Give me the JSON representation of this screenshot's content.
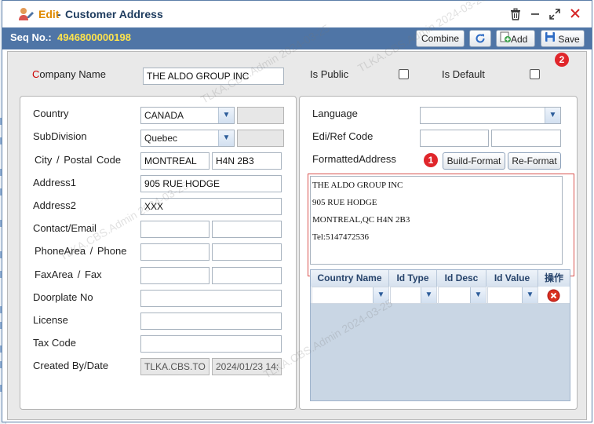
{
  "window": {
    "title_prefix": "Edit",
    "title_separator": "-",
    "title": "Customer Address",
    "icons": {
      "app": "user-edit-icon",
      "trash": "trash-icon",
      "minimize": "minimize-icon",
      "maximize": "maximize-icon",
      "close": "close-icon"
    }
  },
  "toolbar": {
    "seq_label": "Seq No.:",
    "seq_value": "4946800000198",
    "combine_label": "Combine",
    "add_label": "Add",
    "save_label": "Save"
  },
  "header_fields": {
    "company_name_label_first": "C",
    "company_name_label_rest": "ompany Name",
    "company_name_value": "THE ALDO GROUP INC",
    "is_public_label": "Is Public",
    "is_default_label": "Is Default"
  },
  "left": {
    "country_label": "Country",
    "country_value": "CANADA",
    "subdivision_label": "SubDivision",
    "subdivision_value": "Quebec",
    "city_postal_label": "City / Postal Code",
    "city_value": "MONTREAL",
    "postal_value": "H4N 2B3",
    "address1_label": "Address1",
    "address1_value": "905 RUE HODGE",
    "address2_label": "Address2",
    "address2_value": "XXX",
    "contact_email_label": "Contact/Email",
    "phone_label": "PhoneArea / Phone",
    "fax_label": "FaxArea / Fax",
    "doorplate_label": "Doorplate No",
    "license_label": "License",
    "tax_code_label": "Tax Code",
    "created_label": "Created By/Date",
    "created_by_value": "TLKA.CBS.TO",
    "created_date_value": "2024/01/23 14:"
  },
  "right": {
    "language_label": "Language",
    "edi_label": "Edi/Ref Code",
    "formatted_label": "FormattedAddress",
    "build_format_label": "Build-Format",
    "re_format_label": "Re-Format",
    "formatted_lines": [
      "THE ALDO GROUP INC",
      "905 RUE HODGE",
      "MONTREAL,QC H4N 2B3",
      "Tel:5147472536"
    ],
    "grid_headers": [
      "Country Name",
      "Id Type",
      "Id Desc",
      "Id Value",
      "操作"
    ]
  },
  "annotations": {
    "badge1": "1",
    "badge2": "2"
  },
  "watermark": "TLKA.CBS.Admin 2024-03-25",
  "colors": {
    "accent": "#4f75a6",
    "seq_value": "#ffe44d",
    "title_edit": "#e08a00",
    "highlight_box": "#d9534f",
    "badge": "#e0262b"
  }
}
